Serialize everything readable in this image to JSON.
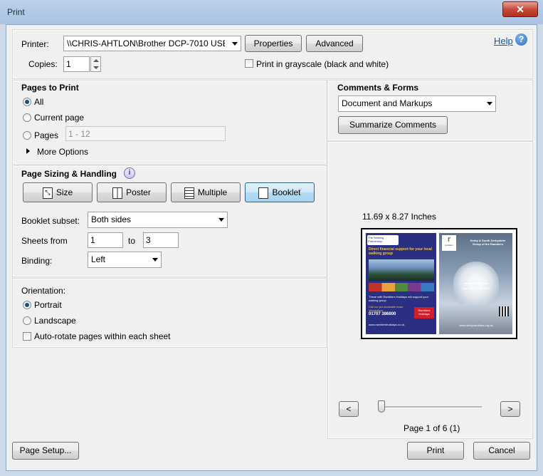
{
  "window": {
    "title": "Print"
  },
  "printer": {
    "label": "Printer:",
    "value": "\\\\CHRIS-AHTLON\\Brother DCP-7010 USB Printer",
    "properties_label": "Properties",
    "advanced_label": "Advanced",
    "help_label": "Help",
    "copies_label": "Copies:",
    "copies_value": "1",
    "grayscale_label": "Print in grayscale (black and white)"
  },
  "pages": {
    "heading": "Pages to Print",
    "all_label": "All",
    "current_label": "Current page",
    "pages_label": "Pages",
    "pages_placeholder": "1 - 12",
    "more_options_label": "More Options",
    "selected": "all"
  },
  "sizing": {
    "heading": "Page Sizing & Handling",
    "tabs": [
      {
        "label": "Size"
      },
      {
        "label": "Poster"
      },
      {
        "label": "Multiple"
      },
      {
        "label": "Booklet"
      }
    ],
    "active_tab": "Booklet",
    "subset_label": "Booklet subset:",
    "subset_value": "Both sides",
    "sheets_label": "Sheets from",
    "sheets_from": "1",
    "to_label": "to",
    "sheets_to": "3",
    "binding_label": "Binding:",
    "binding_value": "Left"
  },
  "orientation": {
    "heading": "Orientation:",
    "portrait_label": "Portrait",
    "landscape_label": "Landscape",
    "autorotate_label": "Auto-rotate pages within each sheet",
    "selected": "portrait"
  },
  "comments": {
    "heading": "Comments & Forms",
    "value": "Document and Markups",
    "summarize_label": "Summarize Comments"
  },
  "preview": {
    "size_label": "11.69 x 8.27 Inches",
    "prev_label": "<",
    "next_label": ">",
    "page_label": "Page 1 of 6 (1)",
    "left_page": {
      "badge_line1": "The Walking",
      "badge_line2": "Partnership",
      "headline": "Direct financial support for your local walking group",
      "note": "These with Ramblers Holidays will support your walking group",
      "call": "Call our pre-bookable team information",
      "phone": "01707 386800",
      "brand": "Ramblers",
      "brand_sub": "Holidays",
      "url": "www.ramblersholidays.co.uk"
    },
    "right_page": {
      "logo_letter": "r",
      "logo_label": "ramblers",
      "group_line1": "Derby & South Derbyshire",
      "group_line2": "Group of the Ramblers",
      "programme": "Walks Programme",
      "dates": "January – June 2013",
      "url": "www.derbyramblers.org.uk"
    }
  },
  "footer": {
    "page_setup_label": "Page Setup...",
    "print_label": "Print",
    "cancel_label": "Cancel"
  },
  "colors": {
    "accent": "#1b4f87",
    "link": "#0b57c5",
    "active_tab_bg": "#cde6f7"
  }
}
